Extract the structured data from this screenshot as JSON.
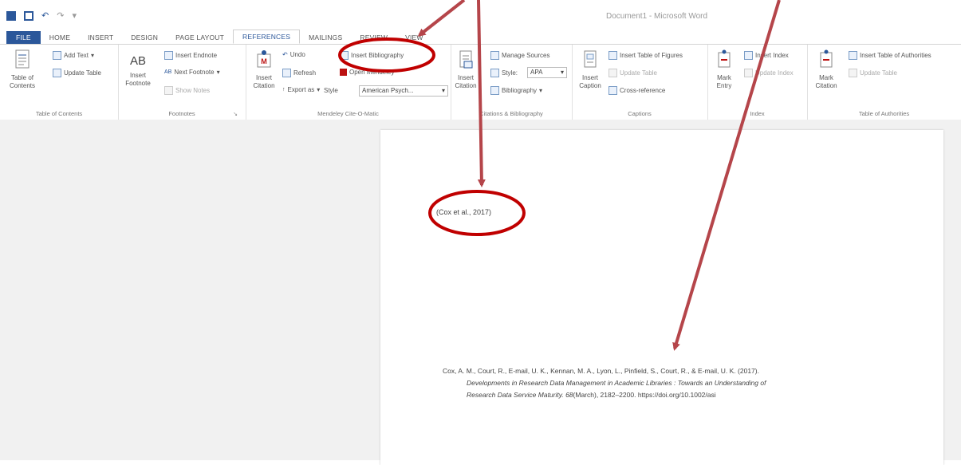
{
  "window": {
    "title": "Document1 - Microsoft Word"
  },
  "tabs": [
    "FILE",
    "HOME",
    "INSERT",
    "DESIGN",
    "PAGE LAYOUT",
    "REFERENCES",
    "MAILINGS",
    "REVIEW",
    "VIEW"
  ],
  "ribbon": {
    "toc": {
      "big": "Table of Contents",
      "add_text": "Add Text",
      "update_table": "Update Table",
      "label": "Table of Contents"
    },
    "footnotes": {
      "big_icon": "AB",
      "big": "Insert Footnote",
      "insert_endnote": "Insert Endnote",
      "next_footnote": "Next Footnote",
      "show_notes": "Show Notes",
      "label": "Footnotes"
    },
    "mendeley": {
      "big": "Insert Citation",
      "undo": "Undo",
      "refresh": "Refresh",
      "export": "Export as",
      "insert_bibliography": "Insert Bibliography",
      "open_mendeley": "Open Mendeley",
      "style_label": "Style",
      "style_value": "American Psych...",
      "label": "Mendeley Cite-O-Matic"
    },
    "citations": {
      "big": "Insert Citation",
      "manage_sources": "Manage Sources",
      "style_label": "Style:",
      "style_value": "APA",
      "bibliography": "Bibliography",
      "label": "Citations & Bibliography"
    },
    "captions": {
      "big": "Insert Caption",
      "insert_tof": "Insert Table of Figures",
      "update_table": "Update Table",
      "cross_ref": "Cross-reference",
      "label": "Captions"
    },
    "index": {
      "big": "Mark Entry",
      "insert_index": "Insert Index",
      "update_index": "Update Index",
      "label": "Index"
    },
    "toa": {
      "big": "Mark Citation",
      "insert_toa": "Insert Table of Authorities",
      "update_table": "Update Table",
      "label": "Table of Authorities"
    }
  },
  "document": {
    "citation": "(Cox et al., 2017)",
    "bibliography": {
      "line1": "Cox, A. M., Court, R., E-mail, U. K., Kennan, M. A., Lyon, L., Pinfield, S., Court, R., & E-mail, U. K. (2017).",
      "line2": "Developments in Research Data Management in Academic Libraries : Towards an Understanding of",
      "line3_italic": "Research Data Service Maturity. 68",
      "line3_rest": "(March), 2182–2200. https://doi.org/10.1002/asi"
    }
  },
  "colors": {
    "accent": "#2b579a",
    "annotation": "#c00000",
    "arrow": "#b5454a"
  }
}
